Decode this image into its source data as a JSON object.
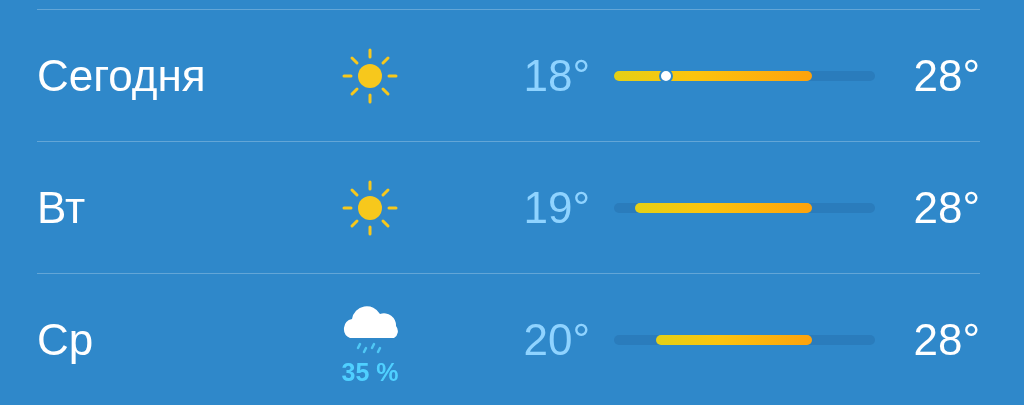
{
  "days": [
    {
      "day": "Сегодня",
      "kind": "sun",
      "low": "18°",
      "high": "28°",
      "now": {
        "level": 0.2
      }
    },
    {
      "day": "Вт",
      "kind": "sun",
      "low": "19°",
      "high": "28°"
    },
    {
      "day": "Ср",
      "kind": "rain",
      "precip": "35 %",
      "low": "20°",
      "high": "28°"
    }
  ]
}
